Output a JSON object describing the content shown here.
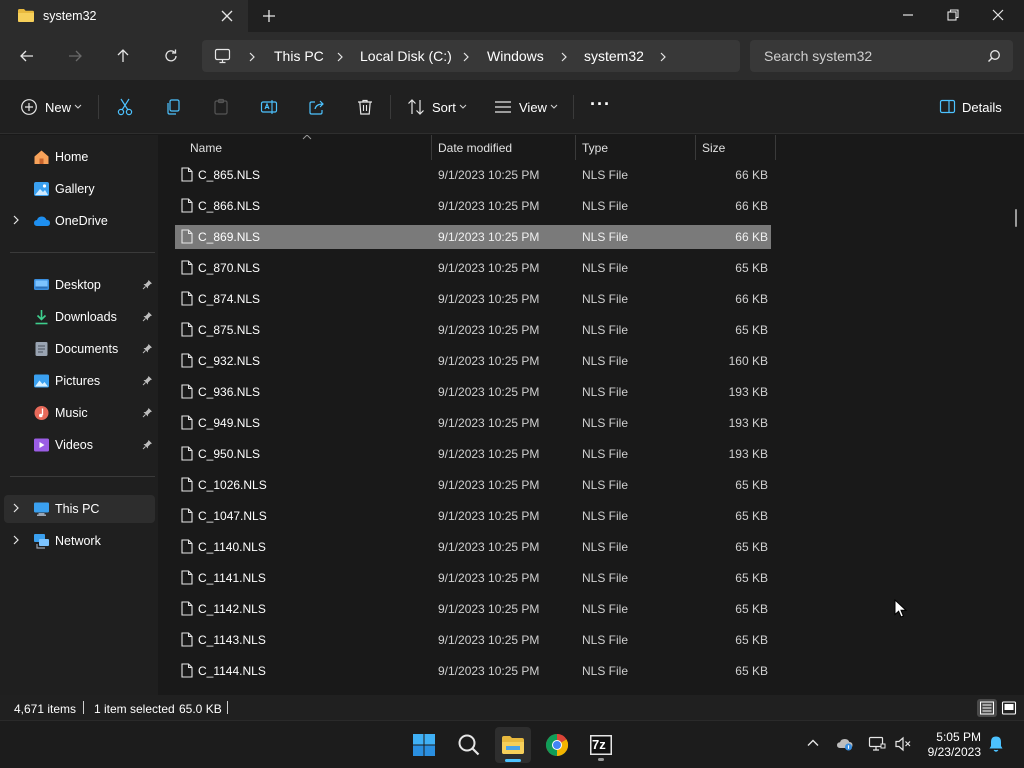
{
  "window": {
    "tab_title": "system32",
    "new_tab_symbol": "+"
  },
  "address": {
    "breadcrumbs": [
      "This PC",
      "Local Disk (C:)",
      "Windows",
      "system32"
    ],
    "search_placeholder": "Search system32"
  },
  "toolbar": {
    "new_label": "New",
    "sort_label": "Sort",
    "view_label": "View",
    "more_label": "···",
    "details_label": "Details"
  },
  "sidebar": {
    "items": [
      {
        "label": "Home"
      },
      {
        "label": "Gallery"
      },
      {
        "label": "OneDrive"
      },
      {
        "label": "Desktop"
      },
      {
        "label": "Downloads"
      },
      {
        "label": "Documents"
      },
      {
        "label": "Pictures"
      },
      {
        "label": "Music"
      },
      {
        "label": "Videos"
      },
      {
        "label": "This PC"
      },
      {
        "label": "Network"
      }
    ]
  },
  "file_list": {
    "columns": {
      "name": "Name",
      "date": "Date modified",
      "type": "Type",
      "size": "Size"
    },
    "rows": [
      {
        "name": "C_865.NLS",
        "date": "9/1/2023 10:25 PM",
        "type": "NLS File",
        "size": "66 KB"
      },
      {
        "name": "C_866.NLS",
        "date": "9/1/2023 10:25 PM",
        "type": "NLS File",
        "size": "66 KB"
      },
      {
        "name": "C_869.NLS",
        "date": "9/1/2023 10:25 PM",
        "type": "NLS File",
        "size": "66 KB"
      },
      {
        "name": "C_870.NLS",
        "date": "9/1/2023 10:25 PM",
        "type": "NLS File",
        "size": "65 KB"
      },
      {
        "name": "C_874.NLS",
        "date": "9/1/2023 10:25 PM",
        "type": "NLS File",
        "size": "66 KB"
      },
      {
        "name": "C_875.NLS",
        "date": "9/1/2023 10:25 PM",
        "type": "NLS File",
        "size": "65 KB"
      },
      {
        "name": "C_932.NLS",
        "date": "9/1/2023 10:25 PM",
        "type": "NLS File",
        "size": "160 KB"
      },
      {
        "name": "C_936.NLS",
        "date": "9/1/2023 10:25 PM",
        "type": "NLS File",
        "size": "193 KB"
      },
      {
        "name": "C_949.NLS",
        "date": "9/1/2023 10:25 PM",
        "type": "NLS File",
        "size": "193 KB"
      },
      {
        "name": "C_950.NLS",
        "date": "9/1/2023 10:25 PM",
        "type": "NLS File",
        "size": "193 KB"
      },
      {
        "name": "C_1026.NLS",
        "date": "9/1/2023 10:25 PM",
        "type": "NLS File",
        "size": "65 KB"
      },
      {
        "name": "C_1047.NLS",
        "date": "9/1/2023 10:25 PM",
        "type": "NLS File",
        "size": "65 KB"
      },
      {
        "name": "C_1140.NLS",
        "date": "9/1/2023 10:25 PM",
        "type": "NLS File",
        "size": "65 KB"
      },
      {
        "name": "C_1141.NLS",
        "date": "9/1/2023 10:25 PM",
        "type": "NLS File",
        "size": "65 KB"
      },
      {
        "name": "C_1142.NLS",
        "date": "9/1/2023 10:25 PM",
        "type": "NLS File",
        "size": "65 KB"
      },
      {
        "name": "C_1143.NLS",
        "date": "9/1/2023 10:25 PM",
        "type": "NLS File",
        "size": "65 KB"
      },
      {
        "name": "C_1144.NLS",
        "date": "9/1/2023 10:25 PM",
        "type": "NLS File",
        "size": "65 KB"
      }
    ]
  },
  "status": {
    "item_count": "4,671 items",
    "selection": "1 item selected",
    "selection_size": "65.0 KB"
  },
  "taskbar": {
    "time": "5:05 PM",
    "date": "9/23/2023",
    "sevenzip_label": "7z"
  },
  "colors": {
    "accent": "#4cc2ff",
    "selected_row": "#7a7a7a",
    "folder": "#f3c54b"
  }
}
